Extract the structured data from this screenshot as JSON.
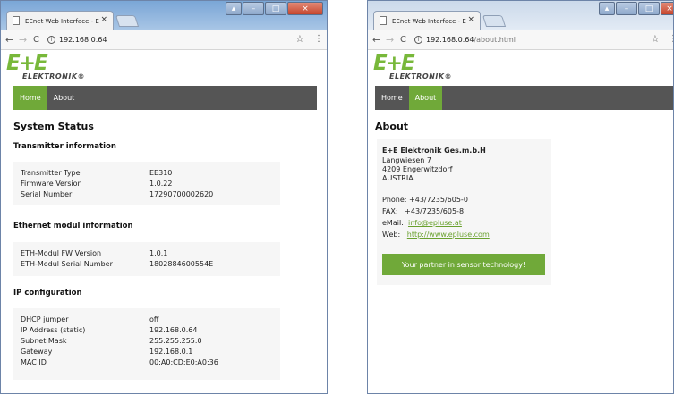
{
  "browser": {
    "tab_title": "EEnet Web Interface - E· ×",
    "tab_title_text": "EEnet Web Interface - E·",
    "tab_close": "×",
    "back": "←",
    "forward": "→",
    "reload": "C",
    "info": "i",
    "star": "☆",
    "menu": "⋮",
    "min": "–",
    "max": "□",
    "close": "×",
    "extra": "▴"
  },
  "left_window": {
    "url_host": "192.168.0.64",
    "url_path": ""
  },
  "right_window": {
    "url_host": "192.168.0.64",
    "url_path": "/about.html"
  },
  "logo": {
    "main": "E+E",
    "sub": "ELEKTRONIK®"
  },
  "menu": {
    "home": "Home",
    "about": "About"
  },
  "status": {
    "title": "System Status",
    "transmitter": {
      "heading": "Transmitter information",
      "rows": [
        {
          "key": "Transmitter Type",
          "value": "EE310"
        },
        {
          "key": "Firmware Version",
          "value": "1.0.22"
        },
        {
          "key": "Serial Number",
          "value": "17290700002620"
        }
      ]
    },
    "ethernet": {
      "heading": "Ethernet modul information",
      "rows": [
        {
          "key": "ETH-Modul FW Version",
          "value": "1.0.1"
        },
        {
          "key": "ETH-Modul Serial Number",
          "value": "1802884600554E"
        }
      ]
    },
    "ip": {
      "heading": "IP configuration",
      "rows": [
        {
          "key": "DHCP jumper",
          "value": "off"
        },
        {
          "key": "IP Address (static)",
          "value": "192.168.0.64"
        },
        {
          "key": "Subnet Mask",
          "value": "255.255.255.0"
        },
        {
          "key": "Gateway",
          "value": "192.168.0.1"
        },
        {
          "key": "MAC ID",
          "value": "00:A0:CD:E0:A0:36"
        }
      ]
    }
  },
  "about": {
    "title": "About",
    "company": "E+E Elektronik Ges.m.b.H",
    "street": "Langwiesen 7",
    "city": "4209 Engerwitzdorf",
    "country": "AUSTRIA",
    "phone_label": "Phone:",
    "phone": "+43/7235/605-0",
    "fax_label": "FAX:",
    "fax": "+43/7235/605-8",
    "email_label": "eMail:",
    "email": "info@epluse.at",
    "web_label": "Web:",
    "web": "http://www.epluse.com",
    "partner": "Your partner in sensor technology!"
  }
}
